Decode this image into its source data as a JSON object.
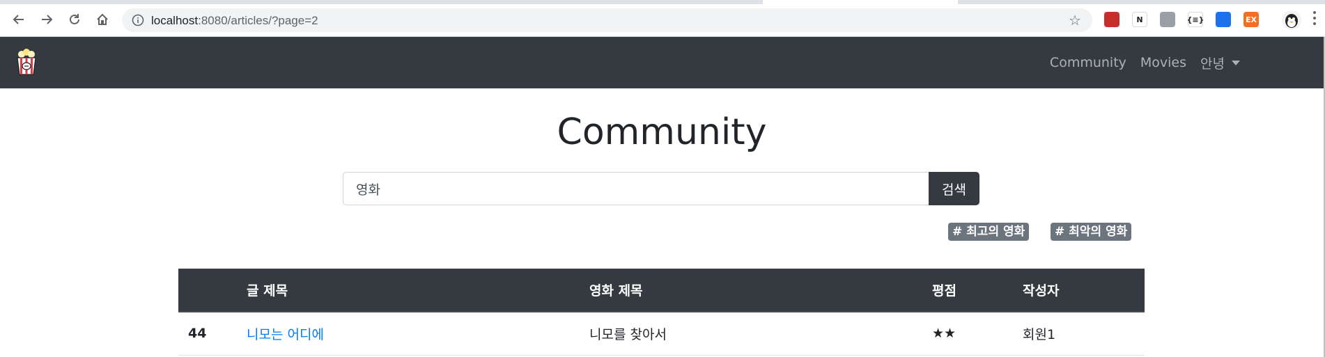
{
  "browser": {
    "url_host": "localhost",
    "url_path": ":8080/articles/?page=2",
    "extensions": [
      {
        "name": "youtube-ext-icon",
        "label": "",
        "bg": "#c4302b"
      },
      {
        "name": "notion-icon",
        "label": "N",
        "bg": "#ffffff"
      },
      {
        "name": "gear-ext-icon",
        "label": "",
        "bg": "#9aa0a6"
      },
      {
        "name": "json-ext-icon",
        "label": "{≡}",
        "bg": "#ffffff"
      },
      {
        "name": "blue-ext-icon",
        "label": "",
        "bg": "#1a73e8"
      },
      {
        "name": "ex-ext-icon",
        "label": "EX",
        "bg": "#f37021"
      }
    ]
  },
  "navbar": {
    "links": [
      "Community",
      "Movies"
    ],
    "user_menu": "안녕"
  },
  "page": {
    "title": "Community"
  },
  "search": {
    "value": "영화",
    "button": "검색"
  },
  "tags": [
    "# 최고의 영화",
    "# 최악의 영화"
  ],
  "table": {
    "headers": [
      "",
      "글 제목",
      "영화 제목",
      "평점",
      "작성자"
    ],
    "rows": [
      {
        "num": "44",
        "title": "니모는 어디에",
        "movie": "니모를 찾아서",
        "rating": "★★",
        "author": "회원1"
      }
    ]
  },
  "colors": {
    "navbar_bg": "#343a40",
    "link": "#007bff",
    "tag_bg": "#6c757d"
  }
}
